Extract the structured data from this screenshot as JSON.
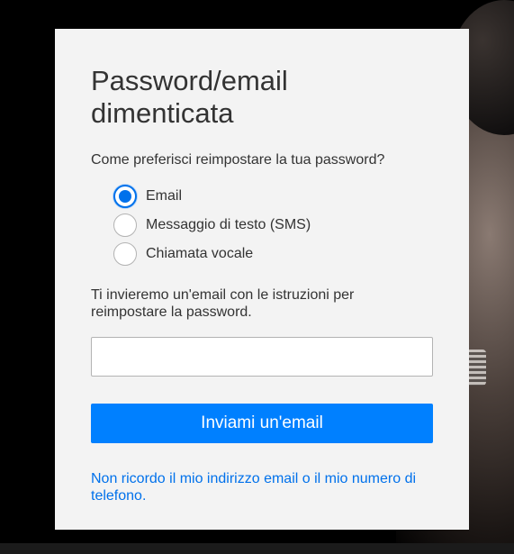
{
  "colors": {
    "accent": "#0071eb",
    "button": "#0080ff",
    "card_background": "#f3f3f3",
    "page_background": "#000000"
  },
  "form": {
    "title": "Password/email dimenticata",
    "question": "Come preferisci reimpostare la tua password?",
    "options": [
      {
        "label": "Email",
        "selected": true
      },
      {
        "label": "Messaggio di testo (SMS)",
        "selected": false
      },
      {
        "label": "Chiamata vocale",
        "selected": false
      }
    ],
    "info_text": "Ti invieremo un'email con le istruzioni per reimpostare la password.",
    "email_input": {
      "value": "",
      "placeholder": ""
    },
    "submit_label": "Inviami un'email",
    "help_link": "Non ricordo il mio indirizzo email o il mio numero di telefono."
  }
}
